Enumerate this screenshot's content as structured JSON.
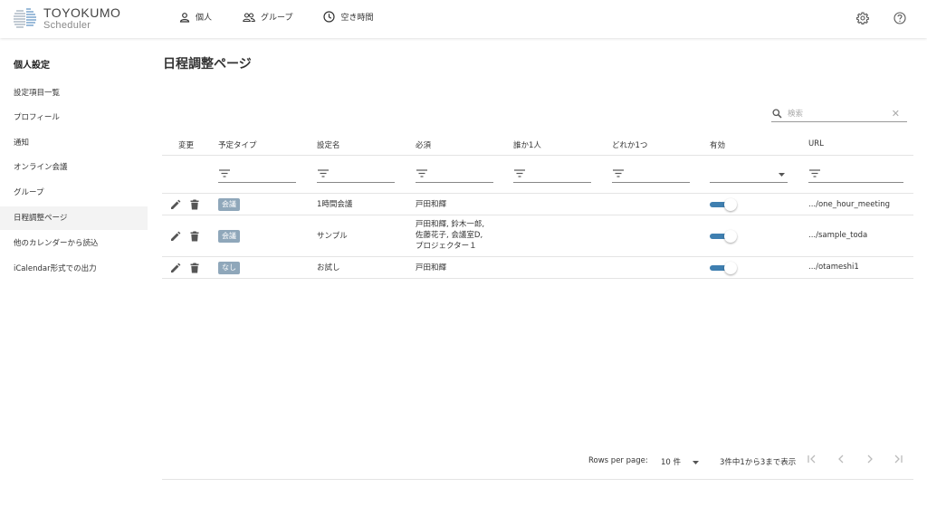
{
  "header": {
    "logo_title": "TOYOKUMO",
    "logo_subtitle": "Scheduler",
    "nav": [
      {
        "label": "個人",
        "icon": "person-icon"
      },
      {
        "label": "グループ",
        "icon": "group-icon"
      },
      {
        "label": "空き時間",
        "icon": "clock-icon"
      }
    ],
    "settings_icon": "gear-icon",
    "help_icon": "help-circle-icon"
  },
  "sidebar": {
    "title": "個人設定",
    "items": [
      {
        "label": "設定項目一覧",
        "active": false
      },
      {
        "label": "プロフィール",
        "active": false
      },
      {
        "label": "通知",
        "active": false
      },
      {
        "label": "オンライン会議",
        "active": false
      },
      {
        "label": "グループ",
        "active": false
      },
      {
        "label": "日程調整ページ",
        "active": true
      },
      {
        "label": "他のカレンダーから読込",
        "active": false
      },
      {
        "label": "iCalendar形式での出力",
        "active": false
      }
    ]
  },
  "main": {
    "title": "日程調整ページ",
    "search": {
      "placeholder": "検索",
      "value": ""
    },
    "columns": [
      "変更",
      "予定タイプ",
      "設定名",
      "必須",
      "誰か1人",
      "どれか1つ",
      "有効",
      "URL"
    ],
    "rows": [
      {
        "type": "会議",
        "name": "1時間会議",
        "required": "戸田和輝",
        "anyone": "",
        "anyof": "",
        "enabled": true,
        "url": ".../one_hour_meeting"
      },
      {
        "type": "会議",
        "name": "サンプル",
        "required_lines": [
          "戸田和輝, 鈴木一郎,",
          "佐藤花子, 会議室D,",
          "プロジェクター１"
        ],
        "anyone": "",
        "anyof": "",
        "enabled": true,
        "url": ".../sample_toda"
      },
      {
        "type": "なし",
        "name": "お試し",
        "required": "戸田和輝",
        "anyone": "",
        "anyof": "",
        "enabled": true,
        "url": ".../otameshi1"
      }
    ],
    "pagination": {
      "rows_per_page_label": "Rows per page:",
      "rows_per_page_value": "10 件",
      "range_text": "3件中1から3まで表示"
    }
  },
  "colors": {
    "accent": "#3f7fb0",
    "badge": "#8fa7ba"
  }
}
